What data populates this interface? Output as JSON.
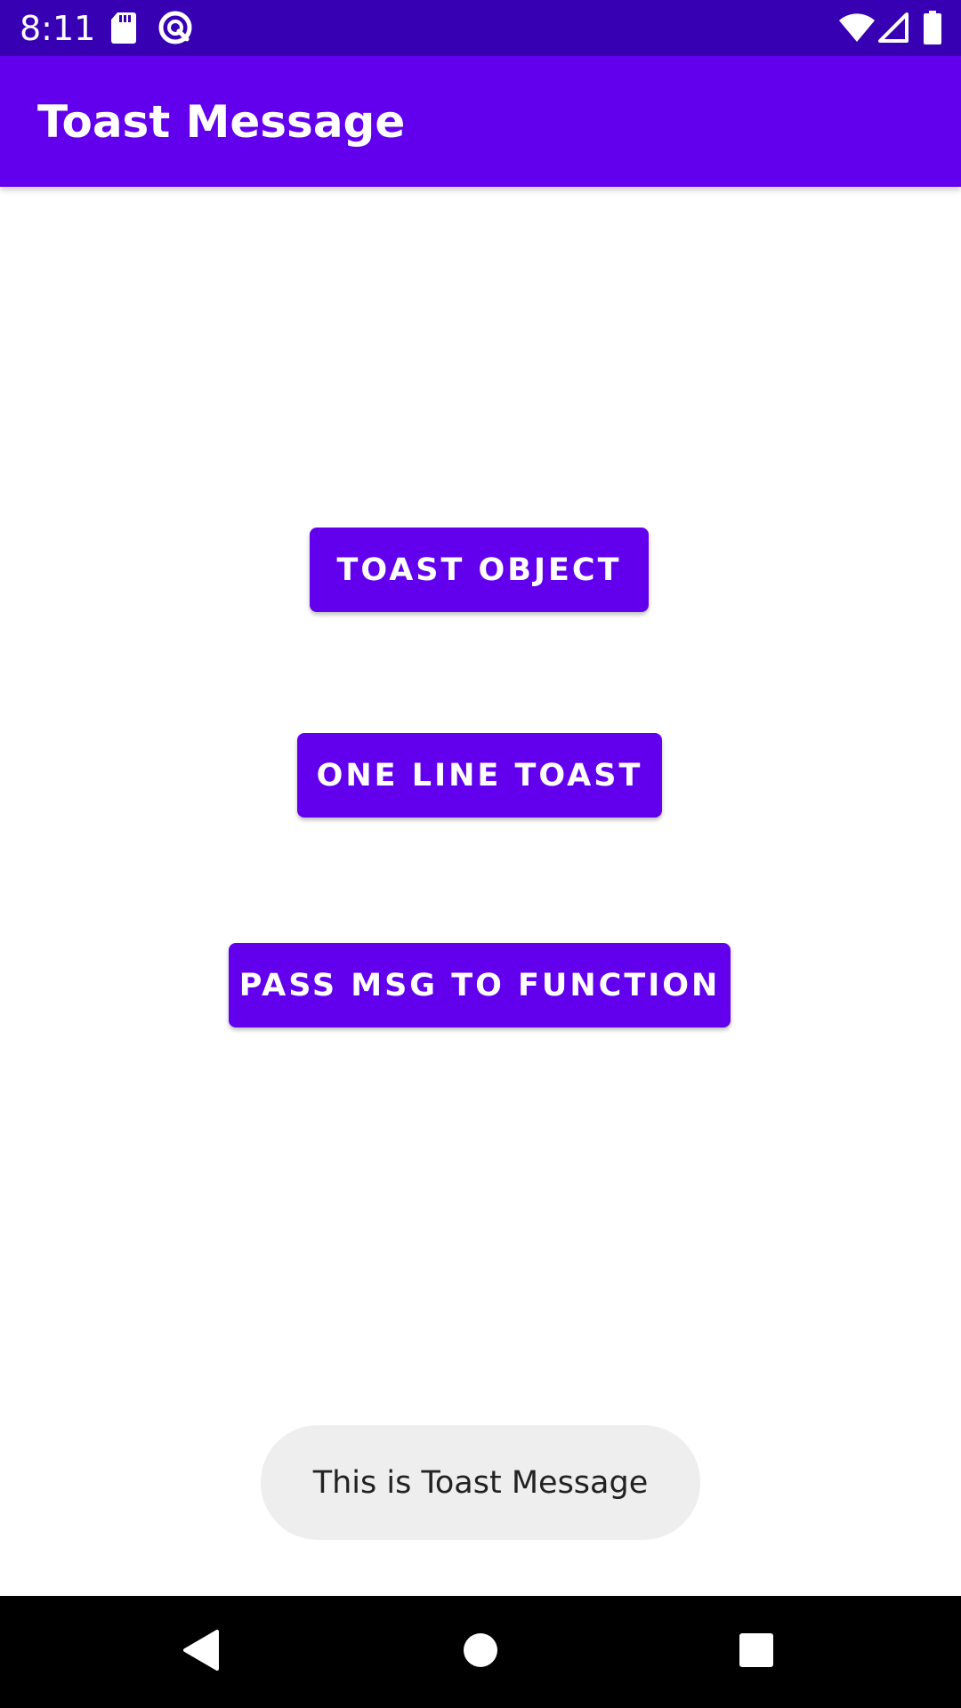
{
  "status_bar": {
    "time": "8:11",
    "icons": [
      "sd-card-icon",
      "sync-circle-icon",
      "wifi-icon",
      "signal-icon",
      "battery-icon"
    ],
    "background": "#3700b3"
  },
  "app_bar": {
    "title": "Toast Message",
    "background": "#6200ee"
  },
  "buttons": {
    "toast_object": "TOAST OBJECT",
    "one_line_toast": "ONE LINE TOAST",
    "pass_msg": "PASS MSG TO FUNCTION",
    "color": "#6200ee"
  },
  "toast": {
    "message": "This is Toast Message"
  },
  "nav_bar": {
    "icons": [
      "back-icon",
      "home-icon",
      "recents-icon"
    ]
  }
}
